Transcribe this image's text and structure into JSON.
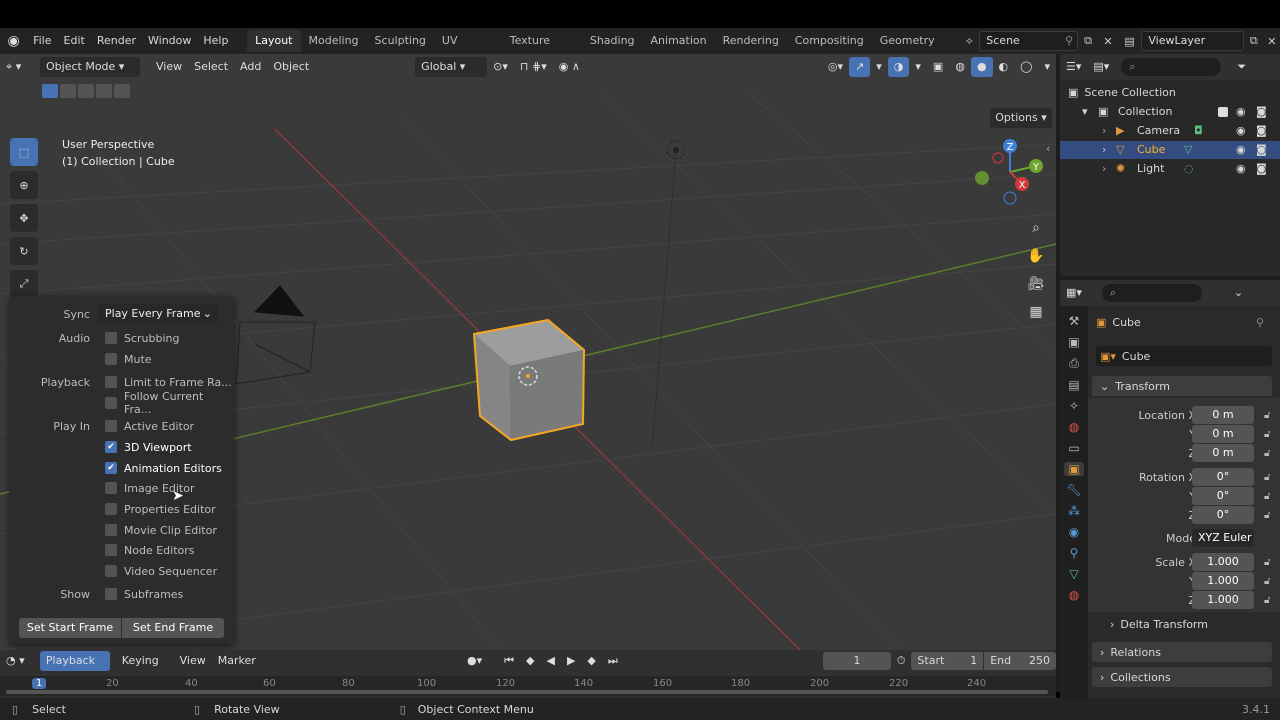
{
  "topbar": {
    "menus": [
      "File",
      "Edit",
      "Render",
      "Window",
      "Help"
    ],
    "workspaces": [
      "Layout",
      "Modeling",
      "Sculpting",
      "UV Editing",
      "Texture Paint",
      "Shading",
      "Animation",
      "Rendering",
      "Compositing",
      "Geometry Noc"
    ],
    "scene": "Scene",
    "view_layer": "ViewLayer"
  },
  "viewport": {
    "mode": "Object Mode",
    "menus": [
      "View",
      "Select",
      "Add",
      "Object"
    ],
    "transform_orientation": "Global",
    "options_label": "Options",
    "perspective": "User Perspective",
    "collection_info": "(1) Collection | Cube",
    "gizmo": {
      "z": "Z",
      "y": "Y",
      "x": "X"
    }
  },
  "popup": {
    "sync_label": "Sync",
    "sync_value": "Play Every Frame",
    "audio_label": "Audio",
    "scrubbing": "Scrubbing",
    "mute": "Mute",
    "playback_label": "Playback",
    "limit": "Limit to Frame Ra...",
    "follow": "Follow Current Fra...",
    "playin_label": "Play In",
    "active_editor": "Active Editor",
    "viewport3d": "3D Viewport",
    "animation_editors": "Animation Editors",
    "image_editor": "Image Editor",
    "properties_editor": "Properties Editor",
    "movie_clip_editor": "Movie Clip Editor",
    "node_editors": "Node Editors",
    "video_sequencer": "Video Sequencer",
    "show_label": "Show",
    "subframes": "Subframes",
    "set_start": "Set Start Frame",
    "set_end": "Set End Frame"
  },
  "timeline": {
    "menus": {
      "playback": "Playback",
      "keying": "Keying",
      "view": "View",
      "marker": "Marker"
    },
    "current_frame": "1",
    "start_label": "Start",
    "start_value": "1",
    "end_label": "End",
    "end_value": "250",
    "ruler": [
      "1",
      "20",
      "40",
      "60",
      "80",
      "100",
      "120",
      "140",
      "160",
      "180",
      "200",
      "220",
      "240"
    ]
  },
  "outliner": {
    "scene_collection": "Scene Collection",
    "collection": "Collection",
    "items": [
      {
        "label": "Camera"
      },
      {
        "label": "Cube"
      },
      {
        "label": "Light"
      }
    ]
  },
  "properties": {
    "object_name": "Cube",
    "data_name": "Cube",
    "transform_label": "Transform",
    "location_label": "Location X",
    "rotation_label": "Rotation X",
    "scale_label": "Scale X",
    "y": "Y",
    "z": "Z",
    "location": [
      "0 m",
      "0 m",
      "0 m"
    ],
    "rotation": [
      "0°",
      "0°",
      "0°"
    ],
    "mode_label": "Mode",
    "mode_value": "XYZ Euler",
    "scale": [
      "1.000",
      "1.000",
      "1.000"
    ],
    "delta": "Delta Transform",
    "relations": "Relations",
    "collections": "Collections"
  },
  "statusbar": {
    "select": "Select",
    "rotate": "Rotate View",
    "context": "Object Context Menu",
    "version": "3.4.1"
  },
  "colors": {
    "accent": "#4772b3",
    "selection": "#f5a623",
    "x_axis": "#d0383c",
    "y_axis": "#6ea52e"
  }
}
